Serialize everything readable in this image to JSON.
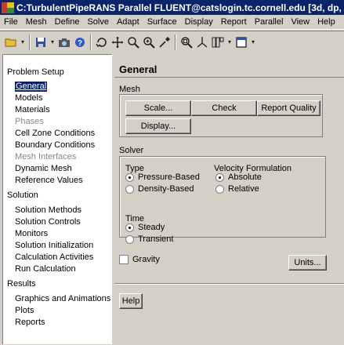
{
  "window": {
    "title": "C:TurbulentPipeRANS Parallel FLUENT@catslogin.tc.cornell.edu  [3d, dp, pbn"
  },
  "menu": [
    "File",
    "Mesh",
    "Define",
    "Solve",
    "Adapt",
    "Surface",
    "Display",
    "Report",
    "Parallel",
    "View",
    "Help"
  ],
  "tree": {
    "problem_setup": "Problem Setup",
    "general": "General",
    "models": "Models",
    "materials": "Materials",
    "phases": "Phases",
    "cell_zone_conditions": "Cell Zone Conditions",
    "boundary_conditions": "Boundary Conditions",
    "mesh_interfaces": "Mesh Interfaces",
    "dynamic_mesh": "Dynamic Mesh",
    "reference_values": "Reference Values",
    "solution": "Solution",
    "solution_methods": "Solution Methods",
    "solution_controls": "Solution Controls",
    "monitors": "Monitors",
    "solution_initialization": "Solution Initialization",
    "calculation_activities": "Calculation Activities",
    "run_calculation": "Run Calculation",
    "results": "Results",
    "graphics_and_animations": "Graphics and Animations",
    "plots": "Plots",
    "reports": "Reports"
  },
  "panel": {
    "title": "General",
    "mesh_label": "Mesh",
    "scale_button": "Scale...",
    "check_button": "Check",
    "report_quality_button": "Report Quality",
    "display_button": "Display...",
    "solver_label": "Solver",
    "type_label": "Type",
    "pressure_based": "Pressure-Based",
    "density_based": "Density-Based",
    "velocity_formulation_label": "Velocity Formulation",
    "absolute": "Absolute",
    "relative": "Relative",
    "time_label": "Time",
    "steady": "Steady",
    "transient": "Transient",
    "gravity": "Gravity",
    "units_button": "Units...",
    "help_button": "Help"
  },
  "state": {
    "solver_type": "Pressure-Based",
    "velocity_formulation": "Absolute",
    "time": "Steady",
    "gravity_checked": false,
    "selected_tree_item": "General"
  }
}
